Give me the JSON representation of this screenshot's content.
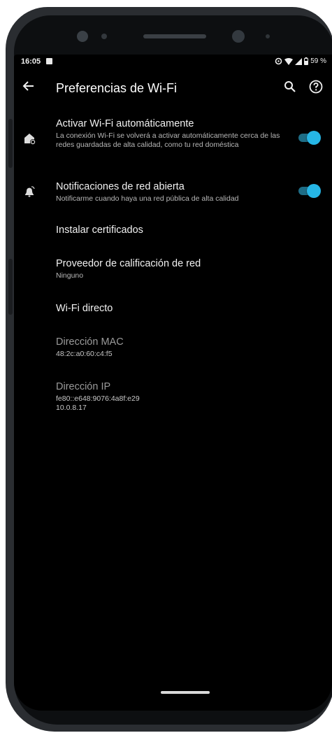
{
  "status": {
    "time": "16:05",
    "battery": "59 %"
  },
  "appbar": {
    "title": "Preferencias de Wi-Fi"
  },
  "preferences": [
    {
      "title": "Activar Wi-Fi automáticamente",
      "subtitle": "La conexión Wi-Fi se volverá a activar automáticamente cerca de las redes guardadas de alta calidad, como tu red doméstica",
      "icon": "wifi-home-icon",
      "toggle": true
    },
    {
      "title": "Notificaciones de red abierta",
      "subtitle": "Notificarme cuando haya una red pública de alta calidad",
      "icon": "notification-bell-icon",
      "toggle": true
    },
    {
      "title": "Instalar certificados"
    },
    {
      "title": "Proveedor de calificación de red",
      "subtitle": "Ninguno"
    },
    {
      "title": "Wi-Fi directo"
    },
    {
      "title": "Dirección MAC",
      "subtitle": "48:2c:a0:60:c4:f5"
    },
    {
      "title": "Dirección IP",
      "subtitle_line1": "fe80::e648:9076:4a8f:e29",
      "subtitle_line2": "10.0.8.17"
    }
  ],
  "colors": {
    "accent": "#26b6e6",
    "background": "#000000"
  }
}
